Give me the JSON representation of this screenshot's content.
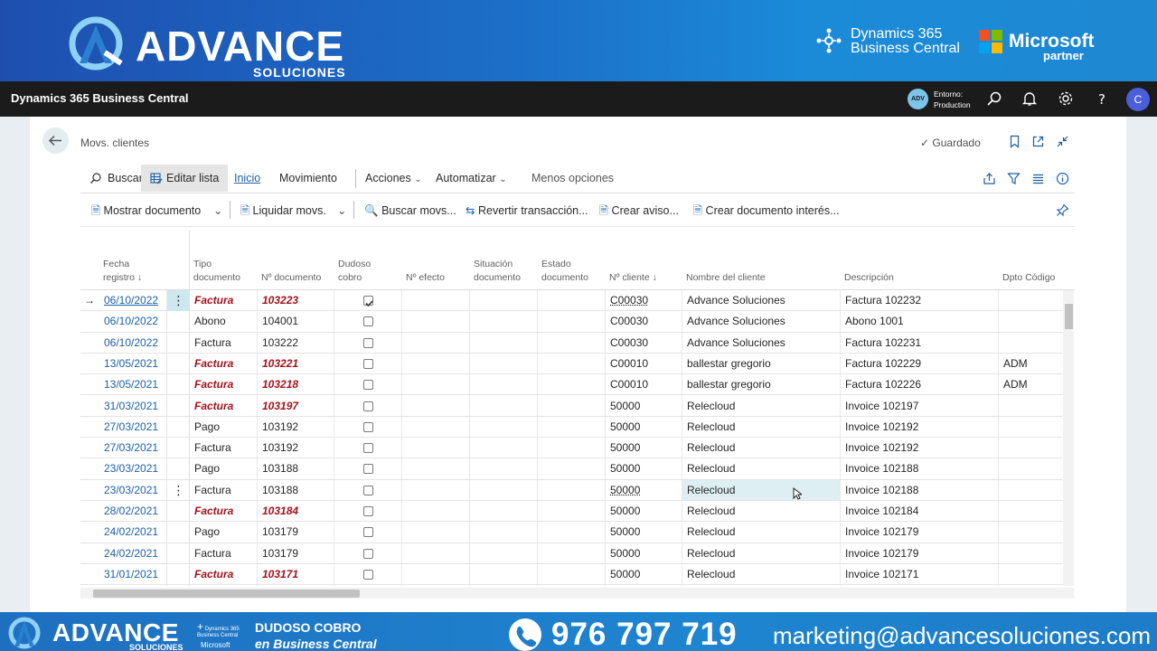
{
  "banner": {
    "brand": "ADVANCE",
    "brand_sub": "SOLUCIONES",
    "d365_line1": "Dynamics 365",
    "d365_line2": "Business Central",
    "ms_name": "Microsoft",
    "ms_partner": "partner"
  },
  "bc_header": {
    "title": "Dynamics 365 Business Central",
    "env_badge": "ADV",
    "env_label": "Entorno:",
    "env_value": "Production",
    "avatar_initial": "C"
  },
  "page": {
    "title": "Movs. clientes",
    "saved_label": "Guardado"
  },
  "actions": {
    "buscar": "Buscar",
    "editar_lista": "Editar lista",
    "inicio": "Inicio",
    "movimiento": "Movimiento",
    "acciones": "Acciones",
    "automatizar": "Automatizar",
    "menos_opciones": "Menos opciones"
  },
  "promoted": {
    "mostrar_documento": "Mostrar documento",
    "liquidar_movs": "Liquidar movs.",
    "buscar_movs": "Buscar movs...",
    "revertir": "Revertir transacción...",
    "crear_aviso": "Crear aviso...",
    "crear_documento_interes": "Crear documento interés..."
  },
  "columns": {
    "fecha_1": "Fecha",
    "fecha_2": "registro ↓",
    "tipo_1": "Tipo",
    "tipo_2": "documento",
    "ndoc": "Nº documento",
    "dudoso_1": "Dudoso",
    "dudoso_2": "cobro",
    "nefecto": "Nº efecto",
    "situacion_1": "Situación",
    "situacion_2": "documento",
    "estado_1": "Estado",
    "estado_2": "documento",
    "ncliente": "Nº cliente ↓",
    "nombre": "Nombre del cliente",
    "descripcion": "Descripción",
    "dpto": "Dpto Código"
  },
  "rows": [
    {
      "fecha": "06/10/2022",
      "tipo": "Factura",
      "ndoc": "103223",
      "dudoso": true,
      "cliente": "C00030",
      "nombre": "Advance Soluciones",
      "descripcion": "Factura 102232",
      "dpto": "",
      "red": true
    },
    {
      "fecha": "06/10/2022",
      "tipo": "Abono",
      "ndoc": "104001",
      "dudoso": false,
      "cliente": "C00030",
      "nombre": "Advance Soluciones",
      "descripcion": "Abono 1001",
      "dpto": "",
      "red": false
    },
    {
      "fecha": "06/10/2022",
      "tipo": "Factura",
      "ndoc": "103222",
      "dudoso": false,
      "cliente": "C00030",
      "nombre": "Advance Soluciones",
      "descripcion": "Factura 102231",
      "dpto": "",
      "red": false
    },
    {
      "fecha": "13/05/2021",
      "tipo": "Factura",
      "ndoc": "103221",
      "dudoso": false,
      "cliente": "C00010",
      "nombre": "ballestar gregorio",
      "descripcion": "Factura 102229",
      "dpto": "ADM",
      "red": true
    },
    {
      "fecha": "13/05/2021",
      "tipo": "Factura",
      "ndoc": "103218",
      "dudoso": false,
      "cliente": "C00010",
      "nombre": "ballestar gregorio",
      "descripcion": "Factura 102226",
      "dpto": "ADM",
      "red": true
    },
    {
      "fecha": "31/03/2021",
      "tipo": "Factura",
      "ndoc": "103197",
      "dudoso": false,
      "cliente": "50000",
      "nombre": "Relecloud",
      "descripcion": "Invoice 102197",
      "dpto": "",
      "red": true
    },
    {
      "fecha": "27/03/2021",
      "tipo": "Pago",
      "ndoc": "103192",
      "dudoso": false,
      "cliente": "50000",
      "nombre": "Relecloud",
      "descripcion": "Invoice 102192",
      "dpto": "",
      "red": false
    },
    {
      "fecha": "27/03/2021",
      "tipo": "Factura",
      "ndoc": "103192",
      "dudoso": false,
      "cliente": "50000",
      "nombre": "Relecloud",
      "descripcion": "Invoice 102192",
      "dpto": "",
      "red": false
    },
    {
      "fecha": "23/03/2021",
      "tipo": "Pago",
      "ndoc": "103188",
      "dudoso": false,
      "cliente": "50000",
      "nombre": "Relecloud",
      "descripcion": "Invoice 102188",
      "dpto": "",
      "red": false
    },
    {
      "fecha": "23/03/2021",
      "tipo": "Factura",
      "ndoc": "103188",
      "dudoso": false,
      "cliente": "50000",
      "nombre": "Relecloud",
      "descripcion": "Invoice 102188",
      "dpto": "",
      "red": false
    },
    {
      "fecha": "28/02/2021",
      "tipo": "Factura",
      "ndoc": "103184",
      "dudoso": false,
      "cliente": "50000",
      "nombre": "Relecloud",
      "descripcion": "Invoice 102184",
      "dpto": "",
      "red": true
    },
    {
      "fecha": "24/02/2021",
      "tipo": "Pago",
      "ndoc": "103179",
      "dudoso": false,
      "cliente": "50000",
      "nombre": "Relecloud",
      "descripcion": "Invoice 102179",
      "dpto": "",
      "red": false
    },
    {
      "fecha": "24/02/2021",
      "tipo": "Factura",
      "ndoc": "103179",
      "dudoso": false,
      "cliente": "50000",
      "nombre": "Relecloud",
      "descripcion": "Invoice 102179",
      "dpto": "",
      "red": false
    },
    {
      "fecha": "31/01/2021",
      "tipo": "Factura",
      "ndoc": "103171",
      "dudoso": false,
      "cliente": "50000",
      "nombre": "Relecloud",
      "descripcion": "Invoice 102171",
      "dpto": "",
      "red": true
    }
  ],
  "footer": {
    "brand": "ADVANCE",
    "brand_sub": "SOLUCIONES",
    "small_d365": "Dynamics 365 Business Central",
    "small_ms": "Microsoft",
    "topic_line1": "DUDOSO COBRO",
    "topic_line2": "en Business Central",
    "phone": "976 797 719",
    "email": "marketing@advancesoluciones.com"
  },
  "colors": {
    "accent_blue": "#1c5fa8",
    "dudoso_red": "#a3131c",
    "header_dark": "#1b1b1b",
    "banner_blue": "#1c6fc8"
  }
}
